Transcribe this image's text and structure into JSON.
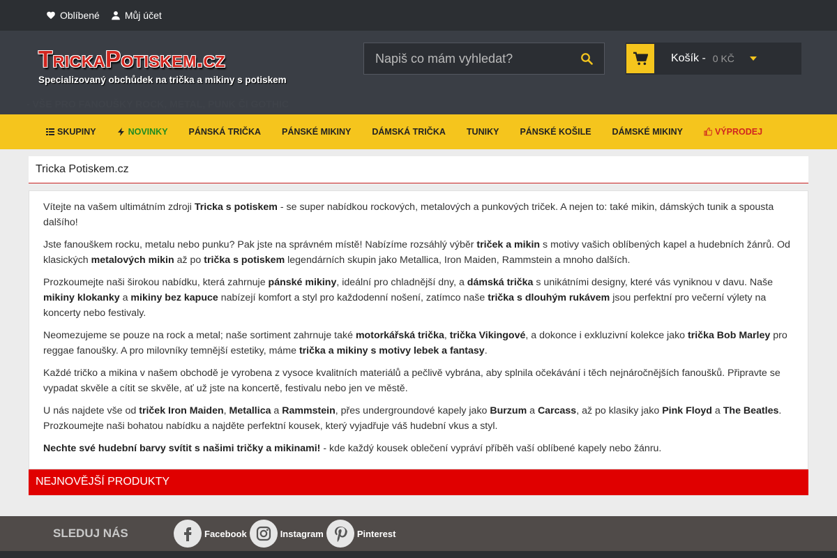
{
  "topbar": {
    "favorites": "Oblíbené",
    "account": "Můj účet"
  },
  "header": {
    "logo_title": "TrickaPotiskem.cz",
    "logo_subtitle": "Specializovaný obchůdek na trička a mikiny s potiskem",
    "tagline": "- VŠE PRO FANOUŠKY ROCK, METAL, PUNK ČI GOTHIC",
    "search_placeholder": "Napiš co mám vyhledat?",
    "cart_label": "Košík -",
    "cart_price": "0 KČ"
  },
  "nav": [
    {
      "label": "SKUPINY",
      "icon": "list-icon"
    },
    {
      "label": "NOVINKY",
      "icon": "bolt-icon"
    },
    {
      "label": "PÁNSKÁ TRIČKA"
    },
    {
      "label": "PÁNSKÉ MIKINY"
    },
    {
      "label": "DÁMSKÁ TRIČKA"
    },
    {
      "label": "TUNIKY"
    },
    {
      "label": "PÁNSKÉ KOŠILE"
    },
    {
      "label": "DÁMSKÉ MIKINY"
    },
    {
      "label": "VÝPRODEJ",
      "icon": "thumbs-up-icon"
    }
  ],
  "main": {
    "title": "Tricka Potiskem.cz",
    "p1": [
      "Vítejte na vašem ultimátním zdroji ",
      "Tricka s potiskem",
      " - se super nabídkou rockových, metalových a punkových triček. A nejen to: také mikin, dámských tunik a spousta dalšího!"
    ],
    "p2": [
      "Jste fanouškem rocku, metalu nebo punku? Pak jste na správném místě! Nabízíme rozsáhlý výběr ",
      "triček a mikin",
      " s motivy vašich oblíbených kapel a hudebních žánrů. Od klasických ",
      "metalových mikin",
      " až po ",
      "trička s potiskem",
      " legendárních skupin jako Metallica, Iron Maiden, Rammstein a mnoho dalších."
    ],
    "p3": [
      "Prozkoumejte naši širokou nabídku, která zahrnuje ",
      "pánské mikiny",
      ", ideální pro chladnější dny, a ",
      "dámská trička",
      " s unikátními designy, které vás vyniknou v davu. Naše ",
      "mikiny klokanky",
      " a ",
      "mikiny bez kapuce",
      " nabízejí komfort a styl pro každodenní nošení, zatímco naše ",
      "trička s dlouhým rukávem",
      " jsou perfektní pro večerní výlety na koncerty nebo festivaly."
    ],
    "p4": [
      "Neomezujeme se pouze na rock a metal; naše sortiment zahrnuje také ",
      "motorkářská trička",
      ", ",
      "trička Vikingové",
      ", a dokonce i exkluzivní kolekce jako ",
      "trička Bob Marley",
      " pro reggae fanoušky. A pro milovníky temnější estetiky, máme ",
      "trička a mikiny s motivy lebek a fantasy",
      "."
    ],
    "p5": [
      "Každé tričko a mikina v našem obchodě je vyrobena z vysoce kvalitních materiálů a pečlivě vybrána, aby splnila očekávání i těch nejnáročnějších fanoušků. Připravte se vypadat skvěle a cítit se skvěle, ať už jste na koncertě, festivalu nebo jen ve městě."
    ],
    "p6": [
      "U nás najdete vše od ",
      "triček Iron Maiden",
      ", ",
      "Metallica",
      " a ",
      "Rammstein",
      ", přes undergroundové kapely jako ",
      "Burzum",
      " a ",
      "Carcass",
      ", až po klasiky jako ",
      "Pink Floyd",
      " a ",
      "The Beatles",
      ". Prozkoumejte naši bohatou nabídku a najděte perfektní kousek, který vyjadřuje váš hudební vkus a styl."
    ],
    "p7": [
      "Nechte své hudební barvy svítit s našimi tričky a mikinami!",
      " - kde každý kousek oblečení vypráví příběh vaší oblíbené kapely nebo žánru."
    ],
    "newest": "NEJNOVĚJŠÍ PRODUKTY"
  },
  "footer": {
    "follow": "SLEDUJ NÁS",
    "facebook": "Facebook",
    "instagram": "Instagram",
    "pinterest": "Pinterest"
  },
  "colors": {
    "accent_yellow": "#f5c51d",
    "accent_red": "#e00000",
    "header_bg": "#3a3e45"
  }
}
